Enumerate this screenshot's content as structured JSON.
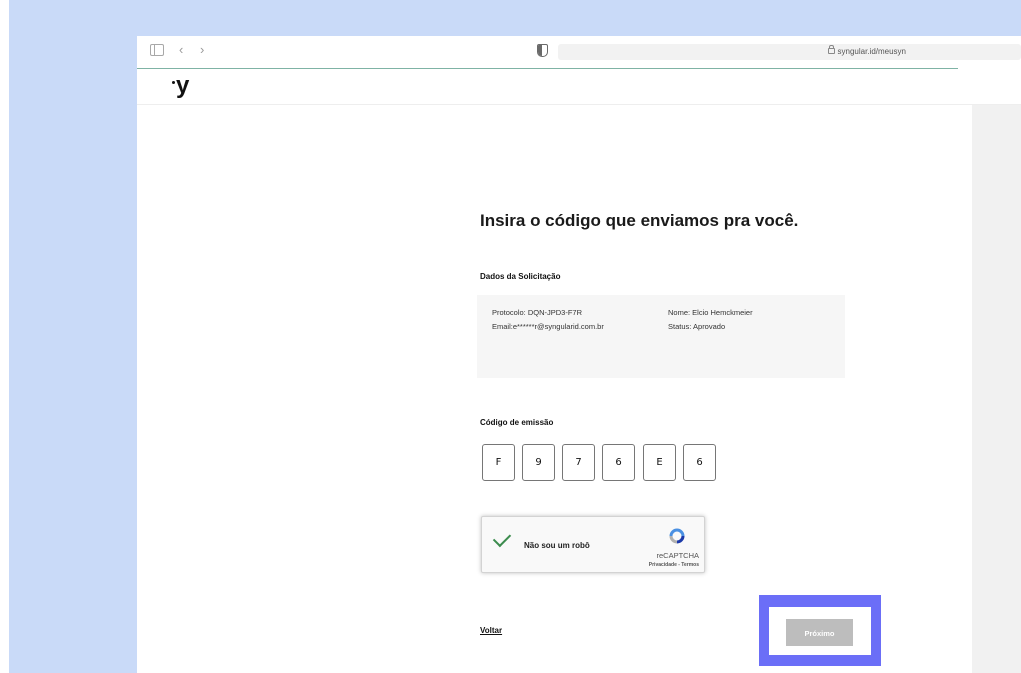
{
  "browser": {
    "url": "syngular.id/meusyn"
  },
  "header": {
    "logo_text": "y"
  },
  "main": {
    "heading": "Insira o código que enviamos pra você.",
    "request_section_title": "Dados da Solicitação",
    "request": {
      "protocol": "Protocolo: DQN-JPD3-F7R",
      "email": "Email:e******r@syngularid.com.br",
      "name": "Nome: Elcio Hemckmeier",
      "status": "Status: Aprovado"
    },
    "code_section_title": "Código de emissão",
    "code_digits": [
      "F",
      "9",
      "7",
      "6",
      "E",
      "6"
    ],
    "captcha": {
      "label": "Não sou um robô",
      "brand": "reCAPTCHA",
      "links": "Privacidade - Termos"
    },
    "back_link": "Voltar",
    "next_button": "Próximo"
  },
  "colors": {
    "highlight": "#6b6ef7",
    "background_frame": "#c9daf8",
    "check_green": "#3c8c4e"
  }
}
